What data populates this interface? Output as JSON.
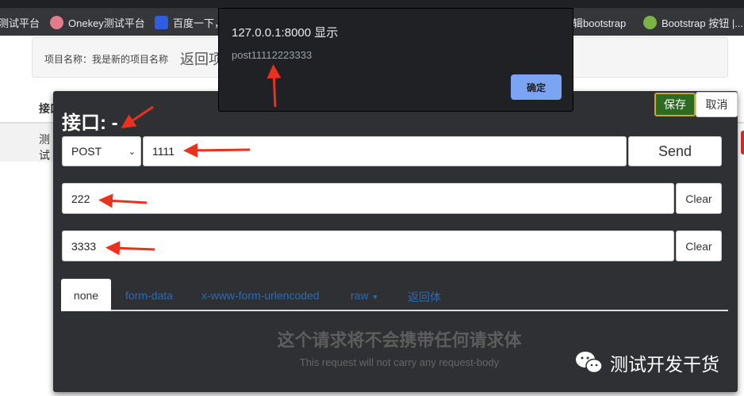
{
  "browser": {
    "bookmarks": [
      {
        "label": "测试平台",
        "icon": "bookmark-icon"
      },
      {
        "label": "Onekey测试平台",
        "icon": "pig-icon",
        "color": "#e37b8a"
      },
      {
        "label": "百度一下，",
        "icon": "baidu-paw-icon",
        "color": "#2f5ee0"
      },
      {
        "label": "辑bootstrap",
        "icon": "bookmark-icon"
      },
      {
        "label": "Bootstrap 按钮 |...",
        "icon": "code-icon",
        "color": "#7cb342"
      }
    ]
  },
  "page": {
    "project_label": "项目名称：我是新的项目名称",
    "back_link": "返回项",
    "table_header": "接口",
    "row_text": "测试"
  },
  "modal": {
    "title": "接口: -",
    "save": "保存",
    "cancel": "取消",
    "method": "POST",
    "url": "1111",
    "send": "Send",
    "field2": "222",
    "field3": "3333",
    "clear": "Clear",
    "tabs": [
      "none",
      "form-data",
      "x-www-form-urlencoded",
      "raw",
      "返回体"
    ],
    "active_tab": "none",
    "empty_title": "这个请求将不会携带任何请求体",
    "empty_subtitle": "This request will not carry any request-body",
    "save_color": "#2e6b22"
  },
  "alert": {
    "title": "127.0.0.1:8000 显示",
    "message": "post11112223333",
    "ok": "确定",
    "ok_color": "#7ba4f4"
  },
  "watermark": {
    "text": "测试开发干货",
    "icon": "wechat-icon"
  },
  "annotation_color": "#e8321e"
}
